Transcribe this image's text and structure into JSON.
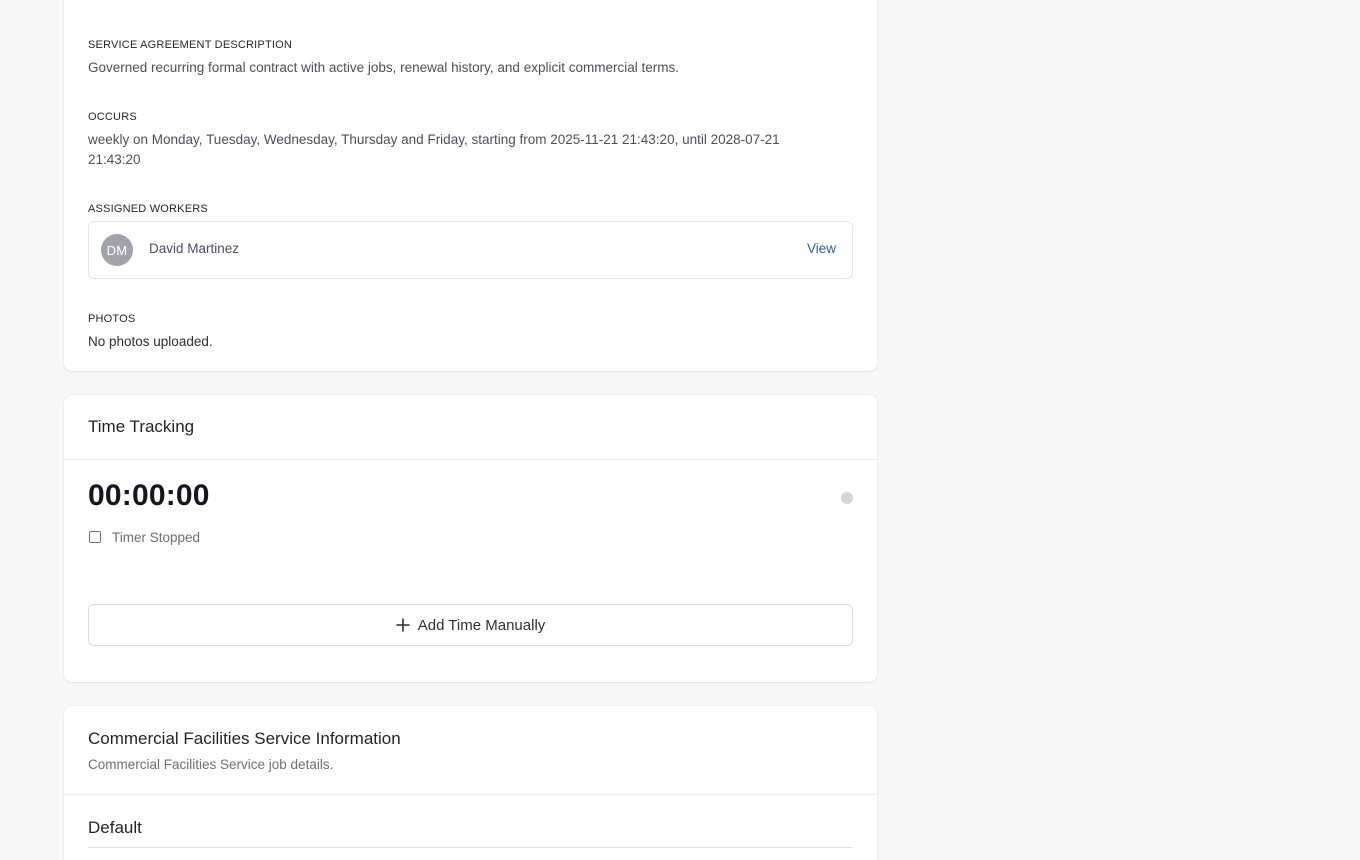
{
  "details": {
    "cut_off_text": "",
    "service_agreement_description": {
      "label": "SERVICE AGREEMENT DESCRIPTION",
      "value": "Governed recurring formal contract with active jobs, renewal history, and explicit commercial terms."
    },
    "occurs": {
      "label": "OCCURS",
      "value": "weekly on Monday, Tuesday, Wednesday, Thursday and Friday, starting from 2025-11-21 21:43:20, until 2028-07-21 21:43:20"
    },
    "assigned_workers": {
      "label": "ASSIGNED WORKERS",
      "workers": [
        {
          "initials": "DM",
          "name": "David Martinez",
          "action_label": "View"
        }
      ]
    },
    "photos": {
      "label": "PHOTOS",
      "value": "No photos uploaded."
    }
  },
  "time_tracking": {
    "title": "Time Tracking",
    "timer_value": "00:00:00",
    "timer_status": "Timer Stopped",
    "add_time_label": "Add Time Manually",
    "status_dot_color": "#d4d6db"
  },
  "service_info": {
    "title": "Commercial Facilities Service Information",
    "subtitle": "Commercial Facilities Service job details.",
    "section_title": "Default"
  },
  "colors": {
    "background": "#f7f7f8",
    "card": "#ffffff",
    "link": "#2f5e9e",
    "avatar": "#a0a3ab"
  }
}
